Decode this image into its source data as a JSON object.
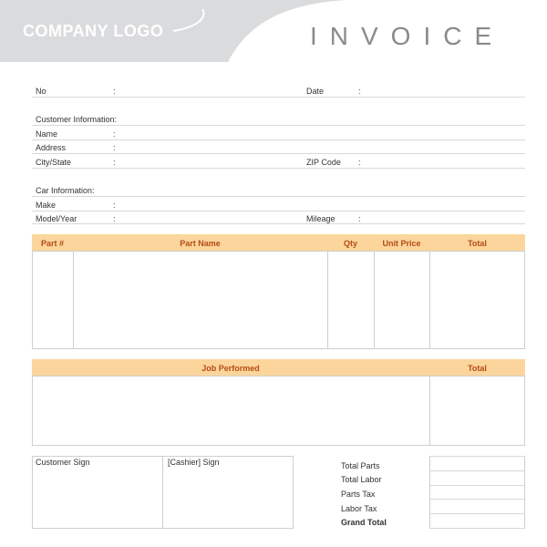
{
  "header": {
    "logo_text": "COMPANY LOGO",
    "title": "INVOICE"
  },
  "top_fields": {
    "no_label": "No",
    "no_colon": ":",
    "date_label": "Date",
    "date_colon": ":"
  },
  "customer": {
    "heading": "Customer Information:",
    "name_label": "Name",
    "address_label": "Address",
    "city_label": "City/State",
    "zip_label": "ZIP Code",
    "colon": ":"
  },
  "car": {
    "heading": "Car Information:",
    "make_label": "Make",
    "model_label": "Model/Year",
    "mileage_label": "Mileage",
    "colon": ":"
  },
  "parts_table": {
    "columns": [
      "Part #",
      "Part Name",
      "Qty",
      "Unit Price",
      "Total"
    ]
  },
  "job_table": {
    "columns": [
      "Job Performed",
      "Total"
    ]
  },
  "footer": {
    "customer_sign": "Customer Sign",
    "cashier_sign": "[Cashier] Sign",
    "totals": [
      "Total Parts",
      "Total Labor",
      "Parts Tax",
      "Labor Tax",
      "Grand Total"
    ]
  },
  "colors": {
    "header_band": "#dadbdd",
    "table_header": "#fbd59b",
    "table_header_text": "#b44c16"
  }
}
